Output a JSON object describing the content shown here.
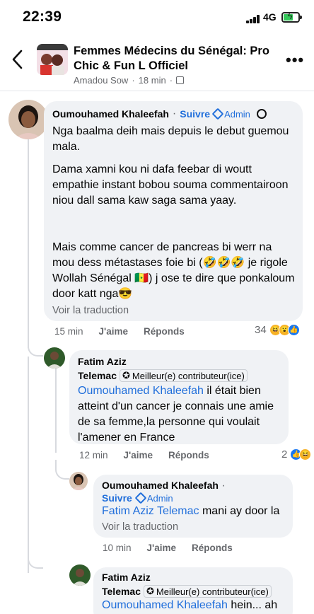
{
  "status": {
    "time": "22:39",
    "network": "4G"
  },
  "header": {
    "title": "Femmes Médecins du Sénégal: Pro Chic & Fun L Officiel",
    "author": "Amadou Sow",
    "time": "18 min"
  },
  "comments": [
    {
      "author": "Oumouhamed Khaleefah",
      "follow": "Suivre",
      "badge": "Admin",
      "paragraphs": [
        "Nga baalma deih mais depuis le debut guemou mala.",
        "Dama xamni kou ni dafa  feebar  di woutt empathie instant bobou souma commentairoon niou dall sama kaw saga sama yaay.",
        "Mais comme cancer de pancreas bi werr na mou dess métastases foie bi (🤣🤣🤣 je rigole Wollah Sénégal 🇸🇳)  j ose te dire que ponkaloum door katt nga😎"
      ],
      "translate": "Voir la traduction",
      "time": "15 min",
      "like": "J'aime",
      "reply": "Réponds",
      "reaction_count": "34"
    },
    {
      "author_line1": "Fatim Aziz",
      "author_line2": "Telemac",
      "badge": "Meilleur(e) contributeur(ice)",
      "mention": "Oumouhamed Khaleefah",
      "text": " il était bien atteint d'un cancer je connais une amie de sa femme,la personne  qui voulait l'amener en France",
      "time": "12 min",
      "like": "J'aime",
      "reply": "Réponds",
      "reaction_count": "2"
    },
    {
      "author": "Oumouhamed Khaleefah",
      "follow": "Suivre",
      "badge": "Admin",
      "mention": "Fatim Aziz Telemac",
      "text": " mani ay door la",
      "translate": "Voir la traduction",
      "time": "10 min",
      "like": "J'aime",
      "reply": "Réponds"
    },
    {
      "author_line1": "Fatim Aziz",
      "author_line2": "Telemac",
      "badge": "Meilleur(e) contributeur(ice)",
      "mention": "Oumouhamed Khaleefah",
      "text": " hein... ah"
    }
  ],
  "icons": {
    "back": "chevron-left-icon",
    "more": "more-icon",
    "admin": "shield-icon",
    "contrib": "badge-icon"
  },
  "colors": {
    "link": "#216fdb",
    "bubble": "#f0f2f5",
    "meta": "#65676b",
    "like": "#1877f2",
    "haha": "#f7b125"
  }
}
